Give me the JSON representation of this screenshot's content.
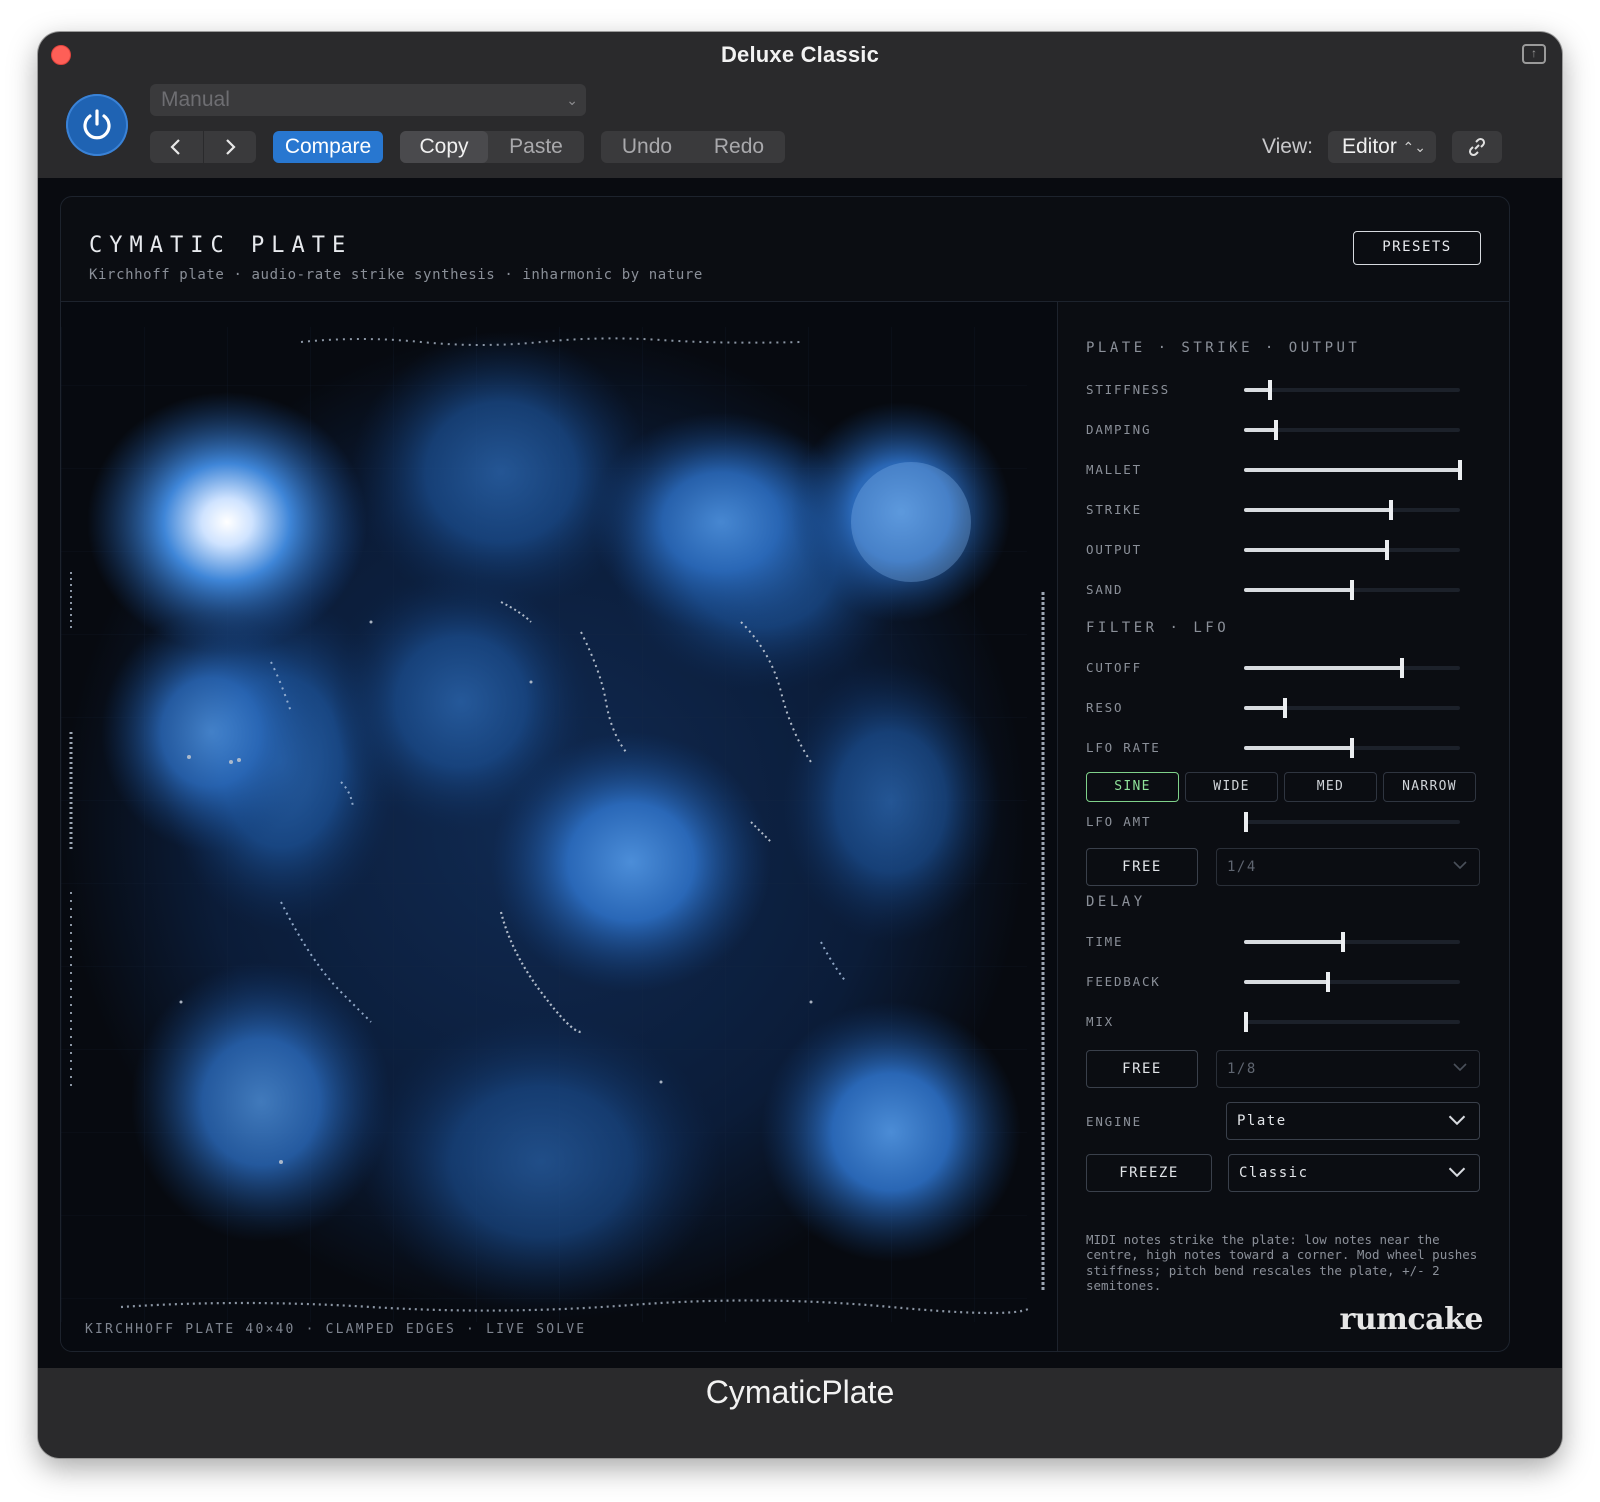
{
  "window": {
    "title": "Deluxe Classic",
    "footer": "CymaticPlate"
  },
  "toolbar": {
    "preset_value": "Manual",
    "compare_label": "Compare",
    "copy_label": "Copy",
    "paste_label": "Paste",
    "undo_label": "Undo",
    "redo_label": "Redo",
    "view_label": "View:",
    "view_value": "Editor"
  },
  "plugin": {
    "title": "CYMATIC PLATE",
    "subtitle": "Kirchhoff plate · audio-rate strike synthesis · inharmonic by nature",
    "presets_label": "PRESETS",
    "plate_footnote": "KIRCHHOFF PLATE 40×40 · CLAMPED EDGES · LIVE SOLVE"
  },
  "sections": {
    "plate": "PLATE · STRIKE · OUTPUT",
    "filter": "FILTER · LFO",
    "delay": "DELAY"
  },
  "sliders": {
    "stiffness": {
      "label": "STIFFNESS",
      "value": 0.12
    },
    "damping": {
      "label": "DAMPING",
      "value": 0.15
    },
    "mallet": {
      "label": "MALLET",
      "value": 1.0
    },
    "strike": {
      "label": "STRIKE",
      "value": 0.68
    },
    "output": {
      "label": "OUTPUT",
      "value": 0.66
    },
    "sand": {
      "label": "SAND",
      "value": 0.5
    },
    "cutoff": {
      "label": "CUTOFF",
      "value": 0.73
    },
    "reso": {
      "label": "RESO",
      "value": 0.19
    },
    "lfo_rate": {
      "label": "LFO RATE",
      "value": 0.5
    },
    "lfo_amt": {
      "label": "LFO AMT",
      "value": 0.01
    },
    "time": {
      "label": "TIME",
      "value": 0.46
    },
    "feedback": {
      "label": "FEEDBACK",
      "value": 0.39
    },
    "mix": {
      "label": "MIX",
      "value": 0.01
    }
  },
  "lfo_shapes": {
    "sine": "SINE",
    "wide": "WIDE",
    "med": "MED",
    "narrow": "NARROW",
    "selected": "SINE"
  },
  "lfo_sync": {
    "mode": "FREE",
    "division": "1/4"
  },
  "delay_sync": {
    "mode": "FREE",
    "division": "1/8"
  },
  "engine": {
    "label": "ENGINE",
    "value": "Plate"
  },
  "freeze": {
    "label": "FREEZE",
    "mode": "Classic"
  },
  "info_text": "MIDI notes strike the plate: low notes near the centre, high notes toward a corner. Mod wheel pushes stiffness; pitch bend rescales the plate, +/- 2 semitones.",
  "brand": "rumcake",
  "colors": {
    "accent": "#2877d0",
    "plate_glow": "#2e6fc0",
    "active_green": "#8fe39a"
  },
  "icons": {
    "power": "power-icon",
    "back": "chevron-left-icon",
    "forward": "chevron-right-icon",
    "link": "link-icon",
    "expand": "expand-icon"
  }
}
